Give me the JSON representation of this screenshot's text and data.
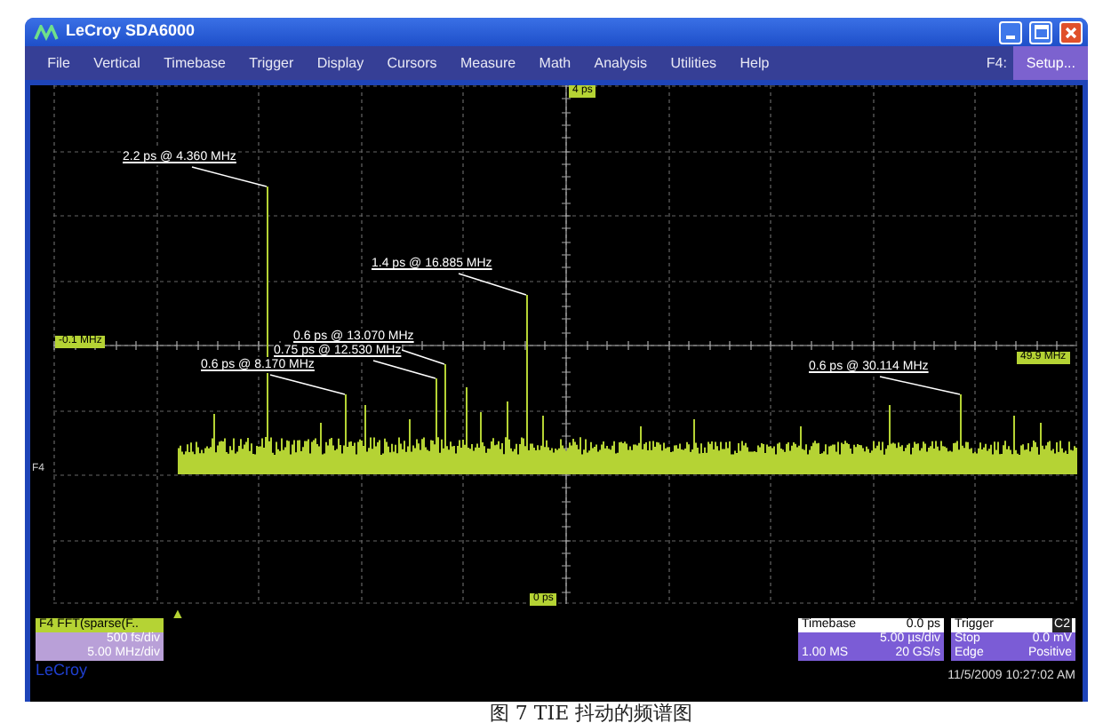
{
  "window": {
    "title": "LeCroy SDA6000"
  },
  "menu": [
    "File",
    "Vertical",
    "Timebase",
    "Trigger",
    "Display",
    "Cursors",
    "Measure",
    "Math",
    "Analysis",
    "Utilities",
    "Help"
  ],
  "function_key": {
    "label": "F4:",
    "button": "Setup..."
  },
  "plot": {
    "axis_tags": [
      {
        "kind": "left",
        "text": "-0.1 MHz"
      },
      {
        "kind": "right",
        "text": "49.9 MHz"
      },
      {
        "kind": "top",
        "text": "4 ps"
      },
      {
        "kind": "bottom",
        "text": "0 ps"
      }
    ],
    "trace_label": "F4",
    "trigger_marker": "▲",
    "annotations": [
      {
        "text": "2.2 ps @ 4.360 MHz"
      },
      {
        "text": "1.4 ps @ 16.885 MHz"
      },
      {
        "text": "0.6 ps @ 13.070 MHz"
      },
      {
        "text": "0.75 ps @ 12.530 MHz"
      },
      {
        "text": "0.6 ps @ 8.170 MHz"
      },
      {
        "text": "0.6 ps @ 30.114 MHz"
      }
    ]
  },
  "trace_panel": {
    "title": "F4 FFT(sparse(F..",
    "scale": "500 fs/div",
    "span": "5.00 MHz/div"
  },
  "brand": "LeCroy",
  "timebase": {
    "title": "Timebase",
    "delay": "0.0 ps",
    "scale": "5.00 µs/div",
    "samples": "1.00 MS",
    "rate": "20 GS/s"
  },
  "trigger": {
    "title": "Trigger",
    "source": "C2",
    "mode": "Stop",
    "threshold": "0.0 mV",
    "type": "Edge",
    "slope": "Positive"
  },
  "timestamp": "11/5/2009 10:27:02 AM",
  "caption": "图 7 TIE 抖动的频谱图"
}
